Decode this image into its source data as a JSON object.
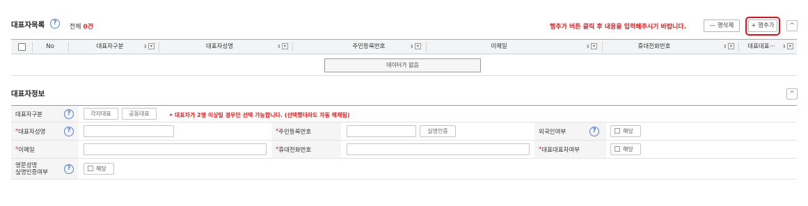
{
  "list_section": {
    "title": "대표자목록",
    "total_prefix": "전체 ",
    "total_count": "0건",
    "notice": "행추가 버튼 클릭 후 내용을 입력해주시기 바랍니다.",
    "delete_row_label": "— 행삭제",
    "add_row_label": "+ 행추가",
    "collapse_symbol": "^"
  },
  "grid": {
    "columns": [
      "No",
      "대표자구분",
      "대표자성명",
      "주민등록번호",
      "이메일",
      "휴대전화번호",
      "대표대표···"
    ],
    "sort_icon": "⇕",
    "filter_icon": "▾",
    "empty_text": "데이터가 없음"
  },
  "info_section": {
    "title": "대표자정보",
    "collapse_symbol": "^"
  },
  "form": {
    "type_label": "대표자구분",
    "type_options": [
      "각자대표",
      "공동대표"
    ],
    "type_notice": "• 대표자가 2명 이상일 경우만 선택 가능합니다. (선택했더라도 자동 해제됨)",
    "name_label": "대표자성명",
    "rrn_label": "주민등록번호",
    "verify_label": "실명인증",
    "foreigner_label": "외국인여부",
    "applicable_label": "해당",
    "email_label": "이메일",
    "mobile_label": "휴대전화번호",
    "main_rep_label": "대표대표자여부",
    "eng_name_label_1": "영문성명",
    "eng_name_label_2": "실명인증여부",
    "required_mark": "*"
  }
}
